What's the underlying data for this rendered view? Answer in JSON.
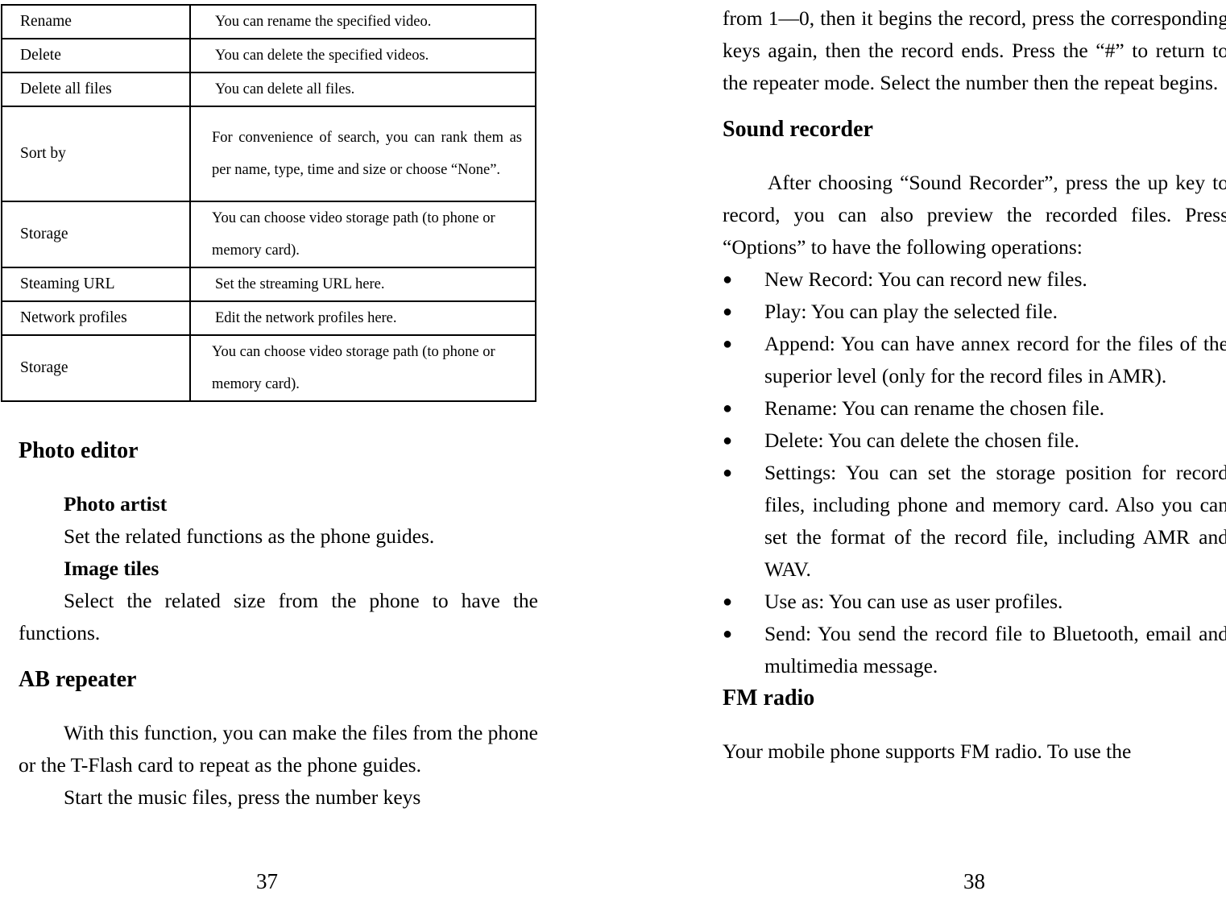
{
  "document": {
    "type": "user-manual-spread",
    "left_page_number": "37",
    "right_page_number": "38"
  },
  "left_page": {
    "table": {
      "rows": [
        {
          "key": "Rename",
          "value": "You can rename the specified video."
        },
        {
          "key": "Delete",
          "value": "You can delete the specified videos."
        },
        {
          "key": "Delete all files",
          "value": "You can delete all files."
        },
        {
          "key": "Sort by",
          "value": "For convenience of search, you can rank them as per name, type, time and size or choose “None”."
        },
        {
          "key": "Storage",
          "value": "You can choose video storage path (to phone or memory card)."
        },
        {
          "key": "Steaming URL",
          "value": "Set the streaming URL here."
        },
        {
          "key": "Network profiles",
          "value": "Edit the network profiles here."
        },
        {
          "key": "Storage",
          "value": "You can choose video storage path (to phone or memory card)."
        }
      ]
    },
    "sections": {
      "photo_editor": {
        "heading": "Photo editor",
        "sub1_title": "Photo artist",
        "sub1_body": "Set the related functions as the phone guides.",
        "sub2_title": "Image tiles",
        "sub2_body": "Select the related size from the phone to have the functions."
      },
      "ab_repeater": {
        "heading": "AB repeater",
        "para1": "With this function, you can make the files from the phone or the T-Flash card to repeat as the phone guides.",
        "para2": "Start the music files, press the number keys"
      }
    }
  },
  "right_page": {
    "continued_paragraph": "from 1—0, then it begins the record, press the corresponding keys again, then the record ends. Press the “#” to return to the repeater mode. Select the number then the repeat begins.",
    "sections": {
      "sound_recorder": {
        "heading": "Sound recorder",
        "intro": "After choosing “Sound Recorder”, press the up key to record, you can also preview the recorded files. Press “Options” to have the following operations:",
        "bullet_char": "●",
        "bullets": [
          "New Record: You can record new files.",
          "Play: You can play the selected file.",
          "Append: You can have annex record for the files of the superior level (only for the record files in AMR).",
          "Rename: You can rename the chosen file.",
          "Delete: You can delete the chosen file.",
          "Settings: You can set the storage position for record files, including phone and memory card. Also you can set the format of the record file, including AMR and WAV.",
          "Use as: You can use as user profiles.",
          "Send: You send the record file to Bluetooth, email and multimedia message."
        ]
      },
      "fm_radio": {
        "heading": "FM radio",
        "para1": "Your mobile phone supports FM radio. To use the"
      }
    }
  }
}
